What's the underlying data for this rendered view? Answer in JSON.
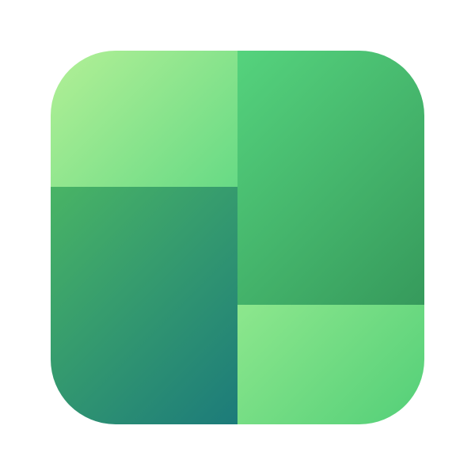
{
  "icon": {
    "name": "green-tile-app-icon",
    "tiles": [
      {
        "name": "top-left",
        "gradient": [
          "#b3f096",
          "#67da85"
        ]
      },
      {
        "name": "bottom-left",
        "gradient": [
          "#49b465",
          "#1c7b7a"
        ]
      },
      {
        "name": "top-right",
        "gradient": [
          "#55d37d",
          "#369a5c"
        ]
      },
      {
        "name": "bottom-right",
        "gradient": [
          "#8de78d",
          "#53cf78"
        ]
      }
    ],
    "background": "#ffffff"
  }
}
